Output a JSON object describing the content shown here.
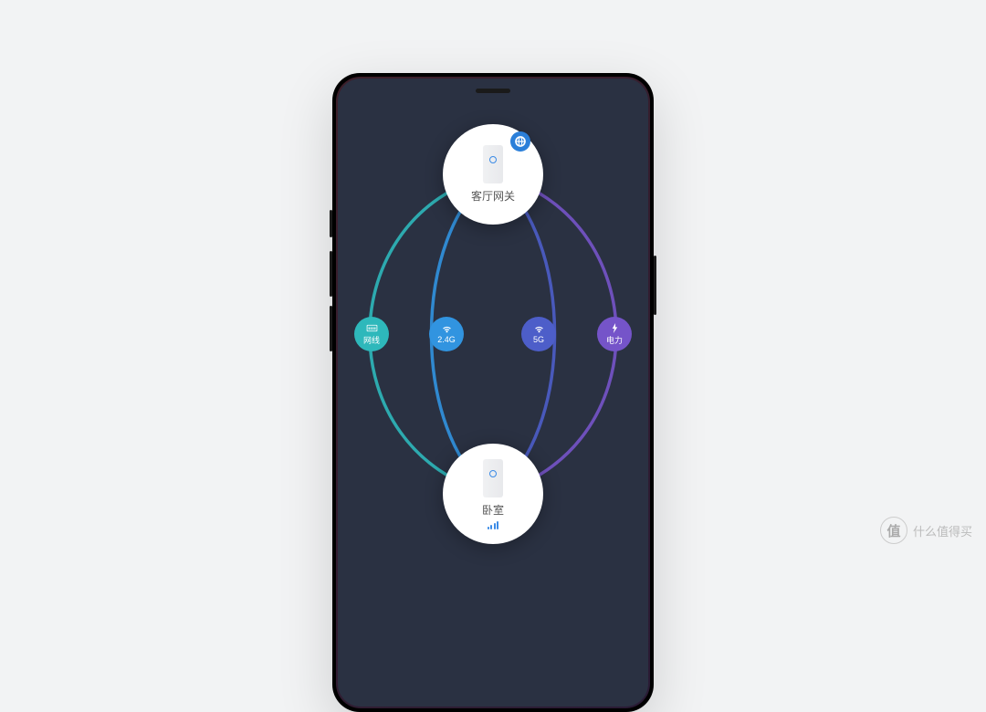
{
  "topNode": {
    "label": "客厅网关",
    "statusIcon": "globe-icon"
  },
  "bottomNode": {
    "label": "卧室",
    "signalIcon": "signal-bars"
  },
  "connections": [
    {
      "label": "网线",
      "icon": "ethernet",
      "color": "#2eb8bb"
    },
    {
      "label": "2.4G",
      "icon": "wifi",
      "color": "#3194e0"
    },
    {
      "label": "5G",
      "icon": "wifi",
      "color": "#4d5ec9"
    },
    {
      "label": "电力",
      "icon": "bolt",
      "color": "#7554c9"
    }
  ],
  "arcColors": [
    "#2eb8bb",
    "#3194e0",
    "#4d5ec9",
    "#7554c9"
  ],
  "watermark": "什么值得买"
}
